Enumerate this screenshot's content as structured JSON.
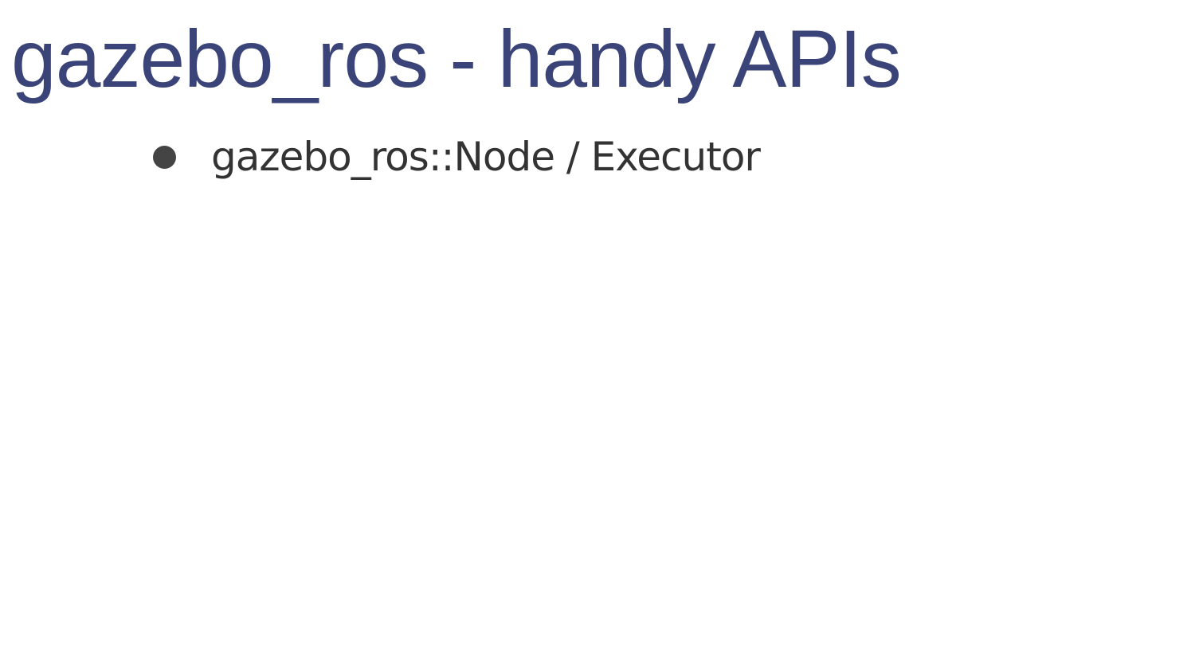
{
  "slide": {
    "title": "gazebo_ros - handy APIs",
    "bullets": [
      {
        "text": "gazebo_ros::Node / Executor"
      }
    ]
  },
  "colors": {
    "title": "#3b4478",
    "body_text": "#333333",
    "bullet": "#444444",
    "background": "#ffffff"
  }
}
